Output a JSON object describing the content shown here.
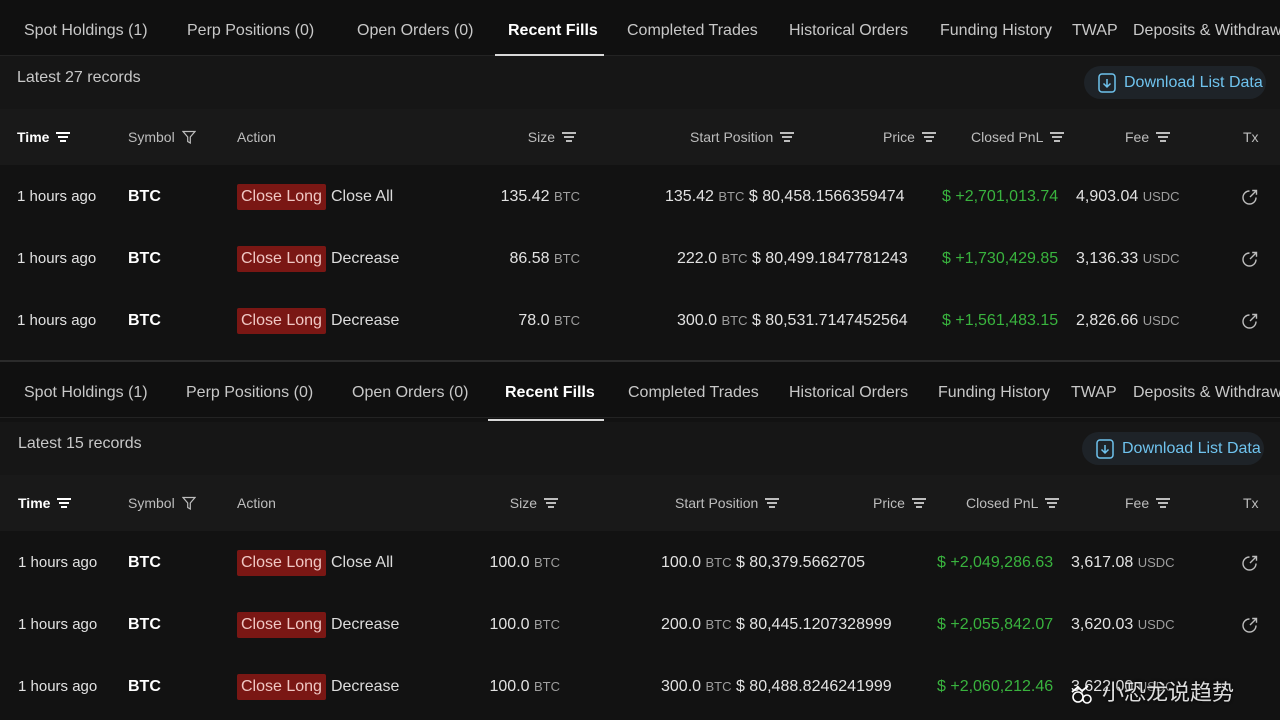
{
  "panels": [
    {
      "tabs": [
        {
          "label": "Spot Holdings (1)"
        },
        {
          "label": "Perp Positions (0)"
        },
        {
          "label": "Open Orders (0)"
        },
        {
          "label": "Recent Fills",
          "active": true
        },
        {
          "label": "Completed Trades"
        },
        {
          "label": "Historical Orders"
        },
        {
          "label": "Funding History"
        },
        {
          "label": "TWAP"
        },
        {
          "label": "Deposits & Withdraw"
        }
      ],
      "records_label": "Latest 27 records",
      "download_label": "Download List Data",
      "columns": {
        "time": "Time",
        "symbol": "Symbol",
        "action": "Action",
        "size": "Size",
        "start_position": "Start Position",
        "price": "Price",
        "closed_pnl": "Closed PnL",
        "fee": "Fee",
        "tx": "Tx"
      },
      "rows": [
        {
          "time": "1 hours ago",
          "symbol": "BTC",
          "action_badge": "Close Long",
          "action_detail": "Close All",
          "size": "135.42",
          "size_unit": "BTC",
          "start_position": "135.42",
          "start_unit": "BTC",
          "price": "$ 80,458.1566359474",
          "closed_pnl": "$ +2,701,013.74",
          "fee": "4,903.04",
          "fee_unit": "USDC"
        },
        {
          "time": "1 hours ago",
          "symbol": "BTC",
          "action_badge": "Close Long",
          "action_detail": "Decrease",
          "size": "86.58",
          "size_unit": "BTC",
          "start_position": "222.0",
          "start_unit": "BTC",
          "price": "$ 80,499.1847781243",
          "closed_pnl": "$ +1,730,429.85",
          "fee": "3,136.33",
          "fee_unit": "USDC"
        },
        {
          "time": "1 hours ago",
          "symbol": "BTC",
          "action_badge": "Close Long",
          "action_detail": "Decrease",
          "size": "78.0",
          "size_unit": "BTC",
          "start_position": "300.0",
          "start_unit": "BTC",
          "price": "$ 80,531.7147452564",
          "closed_pnl": "$ +1,561,483.15",
          "fee": "2,826.66",
          "fee_unit": "USDC"
        }
      ]
    },
    {
      "tabs": [
        {
          "label": "Spot Holdings (1)"
        },
        {
          "label": "Perp Positions (0)"
        },
        {
          "label": "Open Orders (0)"
        },
        {
          "label": "Recent Fills",
          "active": true
        },
        {
          "label": "Completed Trades"
        },
        {
          "label": "Historical Orders"
        },
        {
          "label": "Funding History"
        },
        {
          "label": "TWAP"
        },
        {
          "label": "Deposits & Withdraw"
        }
      ],
      "records_label": "Latest 15 records",
      "download_label": "Download List Data",
      "columns": {
        "time": "Time",
        "symbol": "Symbol",
        "action": "Action",
        "size": "Size",
        "start_position": "Start Position",
        "price": "Price",
        "closed_pnl": "Closed PnL",
        "fee": "Fee",
        "tx": "Tx"
      },
      "rows": [
        {
          "time": "1 hours ago",
          "symbol": "BTC",
          "action_badge": "Close Long",
          "action_detail": "Close All",
          "size": "100.0",
          "size_unit": "BTC",
          "start_position": "100.0",
          "start_unit": "BTC",
          "price": "$ 80,379.5662705",
          "closed_pnl": "$ +2,049,286.63",
          "fee": "3,617.08",
          "fee_unit": "USDC"
        },
        {
          "time": "1 hours ago",
          "symbol": "BTC",
          "action_badge": "Close Long",
          "action_detail": "Decrease",
          "size": "100.0",
          "size_unit": "BTC",
          "start_position": "200.0",
          "start_unit": "BTC",
          "price": "$ 80,445.1207328999",
          "closed_pnl": "$ +2,055,842.07",
          "fee": "3,620.03",
          "fee_unit": "USDC"
        },
        {
          "time": "1 hours ago",
          "symbol": "BTC",
          "action_badge": "Close Long",
          "action_detail": "Decrease",
          "size": "100.0",
          "size_unit": "BTC",
          "start_position": "300.0",
          "start_unit": "BTC",
          "price": "$ 80,488.8246241999",
          "closed_pnl": "$ +2,060,212.46",
          "fee": "3,622.00",
          "fee_unit": "USDC"
        }
      ]
    }
  ],
  "watermark": {
    "text": "小恐龙说趋势"
  },
  "colors": {
    "pnl_positive": "#39b33e",
    "badge_bg": "#7a1714",
    "download_text": "#6fc3ee",
    "background": "#121212"
  },
  "icons": {
    "download": "download-icon",
    "sort": "sort-icon",
    "filter": "filter-icon",
    "tx": "external-link-icon"
  }
}
